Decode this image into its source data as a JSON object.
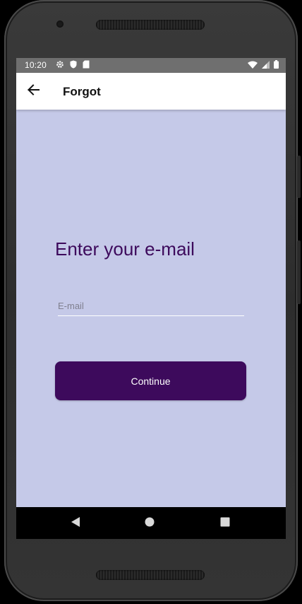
{
  "status_bar": {
    "time": "10:20",
    "left_icons": [
      "gear-icon",
      "shield-icon",
      "sim-card-icon"
    ],
    "right_icons": [
      "wifi-icon",
      "signal-icon",
      "battery-icon"
    ]
  },
  "app_bar": {
    "title": "Forgot",
    "back_icon": "arrow-left-icon"
  },
  "main": {
    "heading": "Enter your e-mail",
    "email_placeholder": "E-mail",
    "email_value": "",
    "continue_label": "Continue"
  },
  "nav_bar": {
    "items": [
      "back-triangle-icon",
      "home-circle-icon",
      "recents-square-icon"
    ]
  },
  "colors": {
    "background": "#c5c9e8",
    "accent": "#3d0a5c",
    "status_bar": "#6f6f6f"
  }
}
